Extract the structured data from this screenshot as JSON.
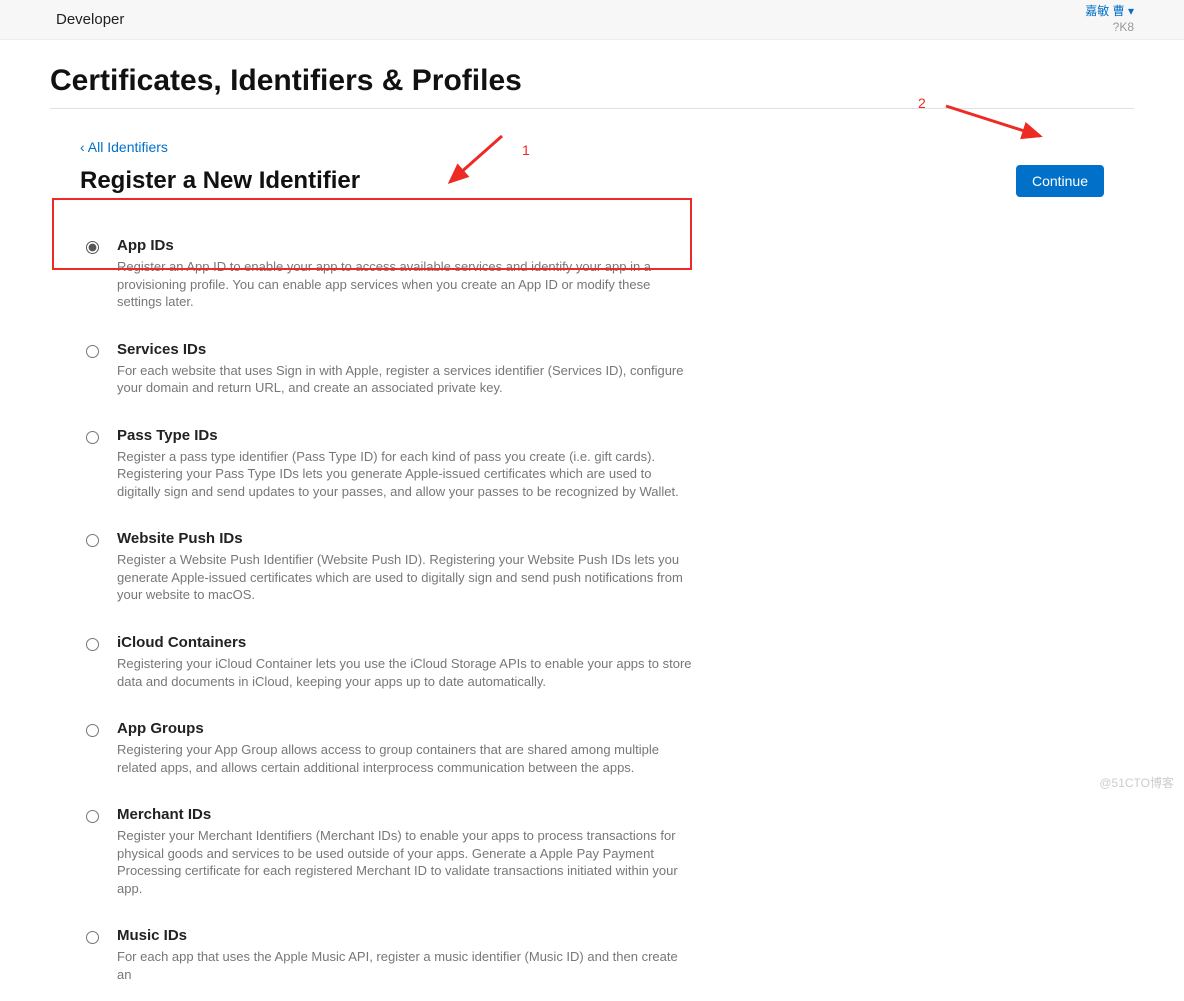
{
  "topbar": {
    "brand": "Developer",
    "account_name": "嘉敏 曹",
    "account_suffix": "▾",
    "account_id": "?K8"
  },
  "page": {
    "title": "Certificates, Identifiers & Profiles",
    "back_label": "‹ All Identifiers",
    "sub_title": "Register a New Identifier",
    "continue_label": "Continue"
  },
  "options": [
    {
      "id": "app-ids",
      "selected": true,
      "title": "App IDs",
      "desc": "Register an App ID to enable your app to access available services and identify your app in a provisioning profile. You can enable app services when you create an App ID or modify these settings later."
    },
    {
      "id": "services-ids",
      "selected": false,
      "title": "Services IDs",
      "desc": "For each website that uses Sign in with Apple, register a services identifier (Services ID), configure your domain and return URL, and create an associated private key."
    },
    {
      "id": "pass-type-ids",
      "selected": false,
      "title": "Pass Type IDs",
      "desc": "Register a pass type identifier (Pass Type ID) for each kind of pass you create (i.e. gift cards). Registering your Pass Type IDs lets you generate Apple-issued certificates which are used to digitally sign and send updates to your passes, and allow your passes to be recognized by Wallet."
    },
    {
      "id": "website-push-ids",
      "selected": false,
      "title": "Website Push IDs",
      "desc": "Register a Website Push Identifier (Website Push ID). Registering your Website Push IDs lets you generate Apple-issued certificates which are used to digitally sign and send push notifications from your website to macOS."
    },
    {
      "id": "icloud-containers",
      "selected": false,
      "title": "iCloud Containers",
      "desc": "Registering your iCloud Container lets you use the iCloud Storage APIs to enable your apps to store data and documents in iCloud, keeping your apps up to date automatically."
    },
    {
      "id": "app-groups",
      "selected": false,
      "title": "App Groups",
      "desc": "Registering your App Group allows access to group containers that are shared among multiple related apps, and allows certain additional interprocess communication between the apps."
    },
    {
      "id": "merchant-ids",
      "selected": false,
      "title": "Merchant IDs",
      "desc": "Register your Merchant Identifiers (Merchant IDs) to enable your apps to process transactions for physical goods and services to be used outside of your apps. Generate a Apple Pay Payment Processing certificate for each registered Merchant ID to validate transactions initiated within your app."
    },
    {
      "id": "music-ids",
      "selected": false,
      "title": "Music IDs",
      "desc": "For each app that uses the Apple Music API, register a music identifier (Music ID) and then create an"
    }
  ],
  "annotations": {
    "label1": "1",
    "label2": "2"
  },
  "watermark": "@51CTO博客"
}
